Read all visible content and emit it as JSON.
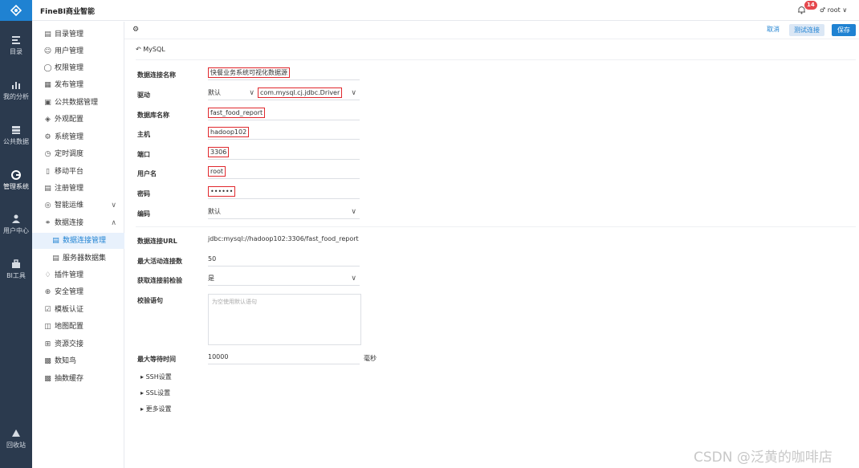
{
  "app": {
    "title": "FineBI商业智能",
    "notification_count": "14",
    "user": "root"
  },
  "rail": [
    {
      "label": "目录",
      "icon": "catalog-icon"
    },
    {
      "label": "我的分析",
      "icon": "analysis-icon"
    },
    {
      "label": "公共数据",
      "icon": "public-data-icon"
    },
    {
      "label": "管理系统",
      "icon": "admin-system-icon"
    },
    {
      "label": "用户中心",
      "icon": "user-center-icon"
    },
    {
      "label": "BI工具",
      "icon": "bi-tool-icon"
    },
    {
      "label": "回收站",
      "icon": "recycle-bin-icon"
    }
  ],
  "nav": [
    {
      "label": "目录管理",
      "icon": "list-icon"
    },
    {
      "label": "用户管理",
      "icon": "user-icon"
    },
    {
      "label": "权限管理",
      "icon": "permission-icon"
    },
    {
      "label": "发布管理",
      "icon": "publish-icon"
    },
    {
      "label": "公共数据管理",
      "icon": "public-data-icon"
    },
    {
      "label": "外观配置",
      "icon": "appearance-icon"
    },
    {
      "label": "系统管理",
      "icon": "system-icon"
    },
    {
      "label": "定时调度",
      "icon": "schedule-icon"
    },
    {
      "label": "移动平台",
      "icon": "mobile-icon"
    },
    {
      "label": "注册管理",
      "icon": "register-icon"
    },
    {
      "label": "智能运维",
      "icon": "ops-icon"
    },
    {
      "label": "数据连接",
      "icon": "data-connection-icon"
    },
    {
      "label": "数据连接管理",
      "icon": "connection-manage-icon"
    },
    {
      "label": "服务器数据集",
      "icon": "server-dataset-icon"
    },
    {
      "label": "插件管理",
      "icon": "plugin-icon"
    },
    {
      "label": "安全管理",
      "icon": "security-icon"
    },
    {
      "label": "模板认证",
      "icon": "template-icon"
    },
    {
      "label": "地图配置",
      "icon": "map-icon"
    },
    {
      "label": "资源交接",
      "icon": "resource-icon"
    },
    {
      "label": "数知鸟",
      "icon": "bird-icon"
    },
    {
      "label": "抽数缓存",
      "icon": "cache-icon"
    }
  ],
  "toolbar": {
    "cancel": "取消",
    "test": "测试连接",
    "save": "保存"
  },
  "back_label": "MySQL",
  "form": {
    "name_label": "数据连接名称",
    "name_value": "快餐业务系统可视化数据源",
    "driver_label": "驱动",
    "driver_default": "默认",
    "driver_value": "com.mysql.cj.jdbc.Driver",
    "db_label": "数据库名称",
    "db_value": "fast_food_report",
    "host_label": "主机",
    "host_value": "hadoop102",
    "port_label": "端口",
    "port_value": "3306",
    "user_label": "用户名",
    "user_value": "root",
    "pwd_label": "密码",
    "pwd_value": "••••••",
    "enc_label": "编码",
    "enc_value": "默认",
    "url_label": "数据连接URL",
    "url_value": "jdbc:mysql://hadoop102:3306/fast_food_report",
    "max_active_label": "最大活动连接数",
    "max_active_value": "50",
    "check_label": "获取连接前检验",
    "check_value": "是",
    "sql_label": "校验语句",
    "sql_placeholder": "为空使用默认语句",
    "wait_label": "最大等待时间",
    "wait_value": "10000",
    "wait_unit": "毫秒",
    "ssh": "SSH设置",
    "ssl": "SSL设置",
    "more": "更多设置"
  },
  "watermark": "CSDN @泛黄的咖啡店",
  "colors": {
    "accent": "#1f82d2",
    "rail": "#2b3a4e",
    "highlight": "#e0282d"
  }
}
